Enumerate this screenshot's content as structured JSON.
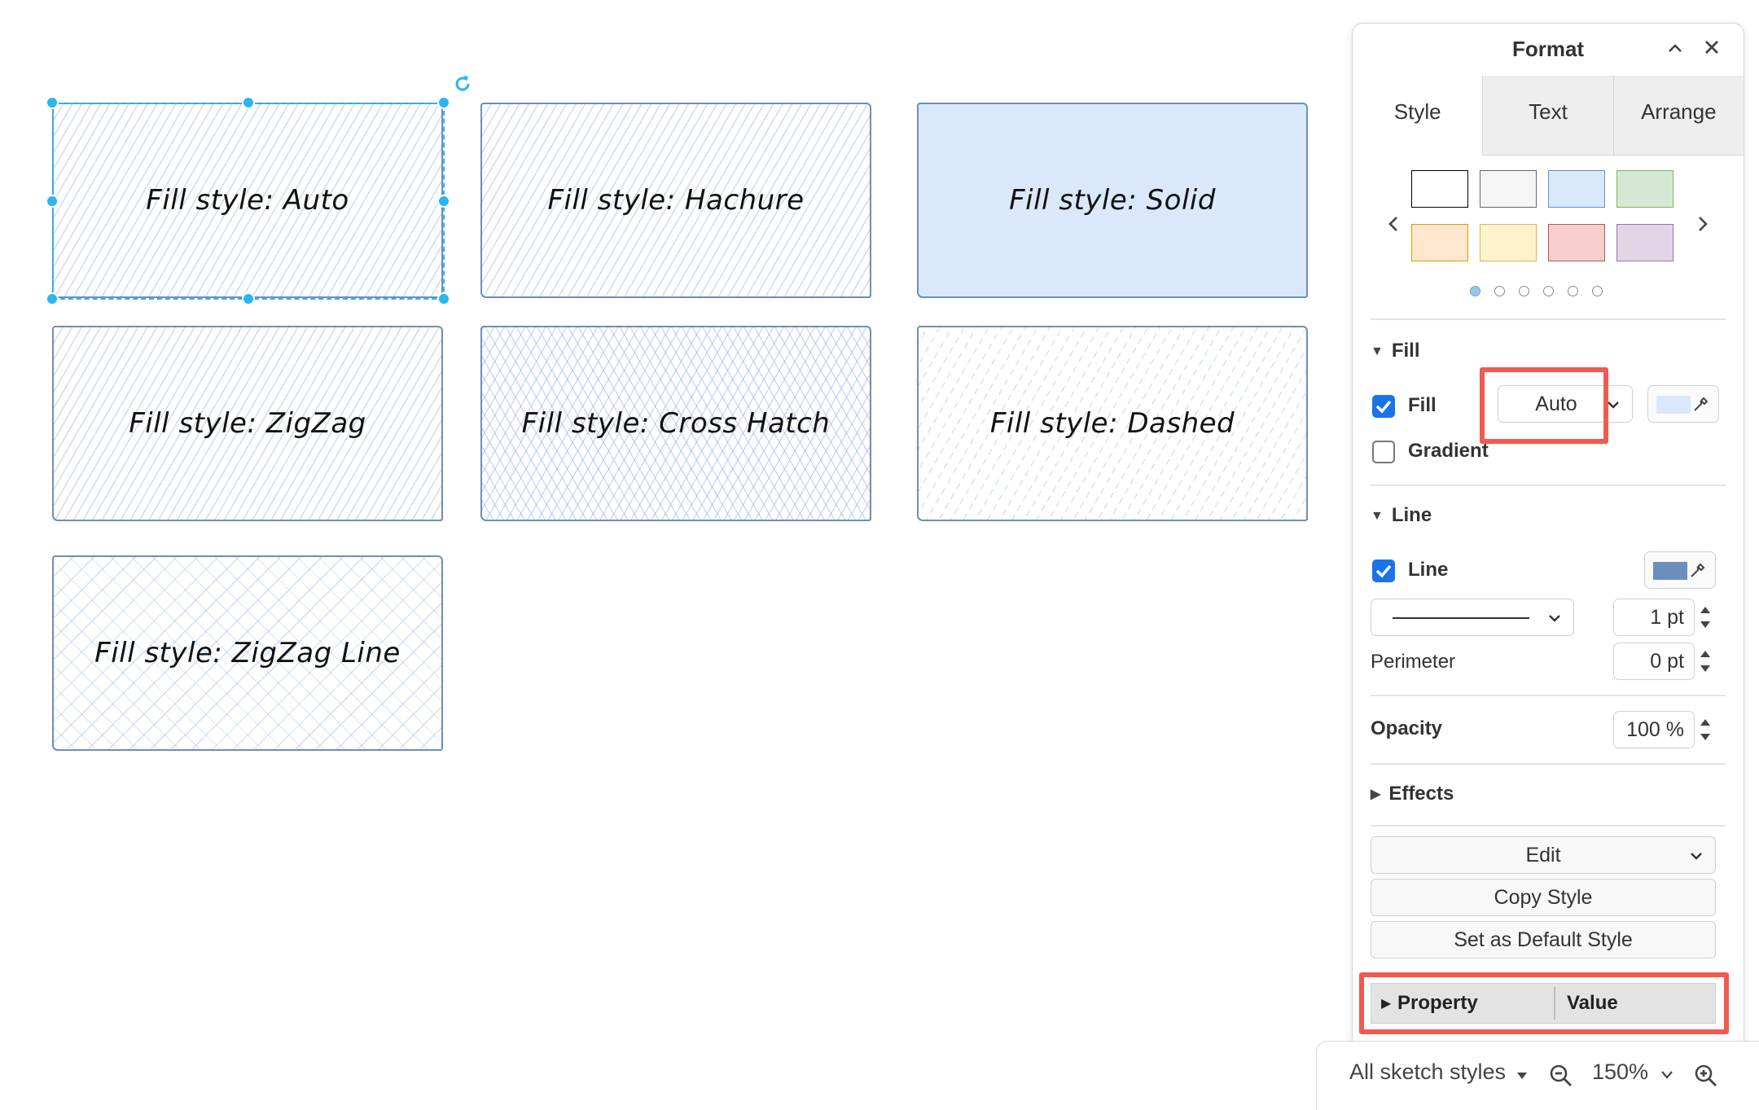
{
  "canvas": {
    "shapes": [
      {
        "label": "Fill style: Auto"
      },
      {
        "label": "Fill style: Hachure"
      },
      {
        "label": "Fill style: Solid"
      },
      {
        "label": "Fill style: ZigZag"
      },
      {
        "label": "Fill style: Cross Hatch"
      },
      {
        "label": "Fill style: Dashed"
      },
      {
        "label": "Fill style: ZigZag Line"
      }
    ],
    "stroke_color": "#6c8ebf",
    "fill_color": "#dae8fc",
    "selection_color": "#29b6f2"
  },
  "format_panel": {
    "title": "Format",
    "tabs": [
      {
        "label": "Style"
      },
      {
        "label": "Text"
      },
      {
        "label": "Arrange"
      }
    ],
    "swatches": [
      {
        "fill": "#ffffff",
        "stroke": "#000000"
      },
      {
        "fill": "#f5f5f5",
        "stroke": "#666666"
      },
      {
        "fill": "#dae8fc",
        "stroke": "#6c8ebf"
      },
      {
        "fill": "#d5e8d4",
        "stroke": "#82b366"
      },
      {
        "fill": "#ffe6cc",
        "stroke": "#d79b00"
      },
      {
        "fill": "#fff2cc",
        "stroke": "#d6b656"
      },
      {
        "fill": "#f8cecc",
        "stroke": "#b85450"
      },
      {
        "fill": "#e1d5e7",
        "stroke": "#9673a6"
      }
    ],
    "pager_pages": 6,
    "fill_section": {
      "title": "Fill",
      "fill_label": "Fill",
      "fill_checked": true,
      "fill_style_value": "Auto",
      "fill_color": "#dae8fc",
      "gradient_label": "Gradient",
      "gradient_checked": false
    },
    "line_section": {
      "title": "Line",
      "line_label": "Line",
      "line_checked": true,
      "line_color": "#6c8ebf",
      "width_value": "1 pt",
      "perimeter_label": "Perimeter",
      "perimeter_value": "0 pt"
    },
    "opacity": {
      "label": "Opacity",
      "value": "100 %"
    },
    "effects": {
      "title": "Effects"
    },
    "buttons": {
      "edit": "Edit",
      "copy_style": "Copy Style",
      "set_default": "Set as Default Style"
    },
    "property_table": {
      "property_header": "Property",
      "value_header": "Value"
    },
    "highlight_color": "#f15a4f"
  },
  "bottom_bar": {
    "style_filter": "All sketch styles",
    "zoom": "150%"
  }
}
